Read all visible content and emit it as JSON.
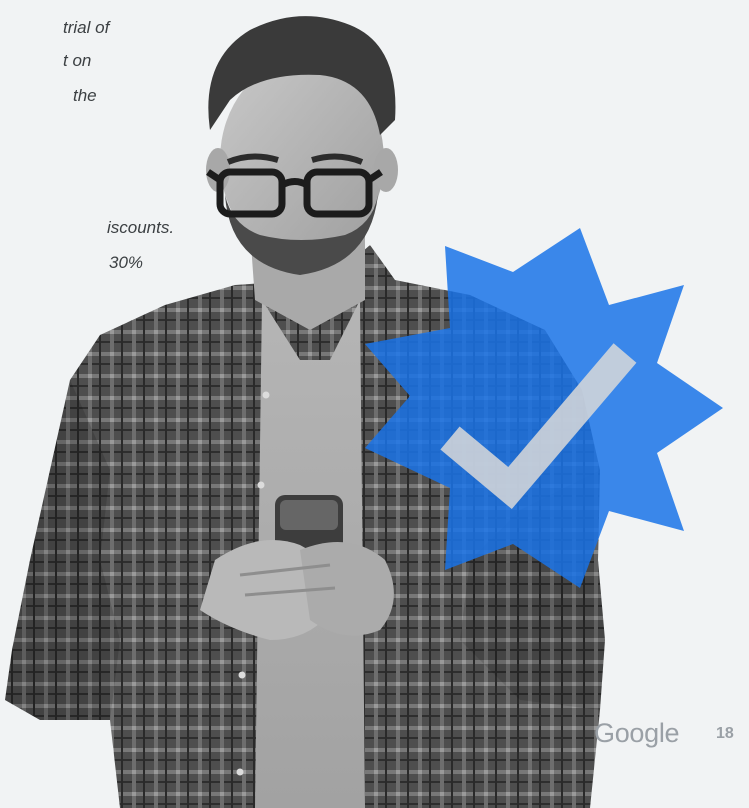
{
  "body_text": {
    "line_1": "trial of",
    "line_2": "t on",
    "line_3": "the",
    "line_4": "iscounts.",
    "line_5": "30%"
  },
  "footer": {
    "brand": "Google",
    "page_number": "18"
  },
  "colors": {
    "background": "#f1f3f4",
    "badge": "#1a73e8",
    "text": "#3c4043",
    "footer": "#9aa0a6"
  },
  "icons": {
    "badge": "verified-badge-checkmark-icon"
  }
}
